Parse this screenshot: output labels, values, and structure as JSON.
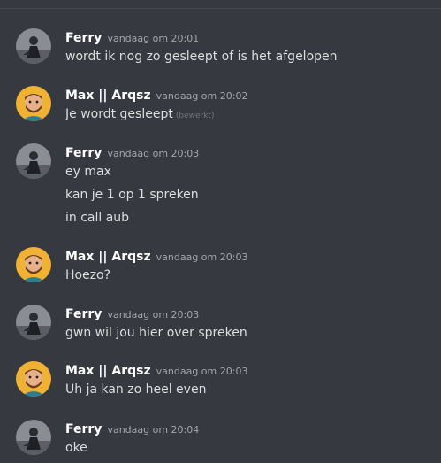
{
  "messages": [
    {
      "author": "Ferry",
      "avatar": "ferry-avatar",
      "timestamp": "vandaag om 20:01",
      "lines": [
        "wordt ik nog zo gesleept of is het afgelopen"
      ]
    },
    {
      "author": "Max || Arqsz",
      "avatar": "max-avatar",
      "timestamp": "vandaag om 20:02",
      "lines": [
        "Je wordt gesleept"
      ],
      "edited": "(bewerkt)"
    },
    {
      "author": "Ferry",
      "avatar": "ferry-avatar",
      "timestamp": "vandaag om 20:03",
      "lines": [
        "ey max",
        "kan je 1 op 1 spreken",
        "in call aub"
      ]
    },
    {
      "author": "Max || Arqsz",
      "avatar": "max-avatar",
      "timestamp": "vandaag om 20:03",
      "lines": [
        "Hoezo?"
      ]
    },
    {
      "author": "Ferry",
      "avatar": "ferry-avatar",
      "timestamp": "vandaag om 20:03",
      "lines": [
        "gwn wil jou hier over spreken"
      ]
    },
    {
      "author": "Max || Arqsz",
      "avatar": "max-avatar",
      "timestamp": "vandaag om 20:03",
      "lines": [
        "Uh ja kan zo heel even"
      ]
    },
    {
      "author": "Ferry",
      "avatar": "ferry-avatar",
      "timestamp": "vandaag om 20:04",
      "lines": [
        "oke"
      ]
    }
  ],
  "colors": {
    "background": "#36393f",
    "author": "#ffffff",
    "timestamp": "#a3a6aa",
    "text": "#dcddde",
    "max_avatar_bg": "#f0b232"
  }
}
